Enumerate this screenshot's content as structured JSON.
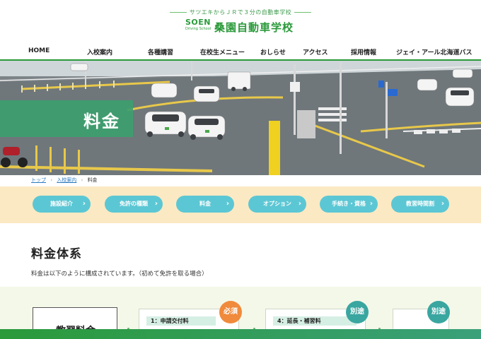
{
  "header": {
    "tagline": "サツエキからＪＲで３分の自動車学校",
    "logo_mark": "SOEN",
    "logo_sub": "Driving School",
    "school_name": "桑園自動車学校"
  },
  "nav": {
    "items": [
      {
        "label": "HOME"
      },
      {
        "label": "入校案内"
      },
      {
        "label": "各種講習"
      },
      {
        "label": "在校生メニュー"
      },
      {
        "label": "おしらせ"
      },
      {
        "label": "アクセス"
      },
      {
        "label": "採用情報"
      },
      {
        "label": "ジェイ・アール北海道バス"
      }
    ]
  },
  "hero": {
    "title": "料金"
  },
  "breadcrumb": {
    "items": [
      {
        "label": "トップ"
      },
      {
        "label": "入校案内"
      },
      {
        "label": "料金"
      }
    ]
  },
  "subnav": {
    "items": [
      {
        "label": "施設紹介"
      },
      {
        "label": "免許の種類"
      },
      {
        "label": "料金"
      },
      {
        "label": "オプション"
      },
      {
        "label": "手続き・資格"
      },
      {
        "label": "教習時間割"
      }
    ]
  },
  "section": {
    "title": "料金体系",
    "desc": "料金は以下のように構成されています。（初めて免許を取る場合）"
  },
  "fees": {
    "main_label": "教習料金",
    "cards": [
      {
        "label": "1：申請交付料",
        "badge": "必須"
      },
      {
        "label": "4：延長・補習料",
        "badge": "別途"
      },
      {
        "label": "",
        "badge": "別途"
      }
    ]
  },
  "colors": {
    "brand_green": "#2a9a3a",
    "pill_teal": "#5cc7d4",
    "band_cream": "#fbe9c3",
    "badge_orange": "#f08a3c",
    "badge_teal": "#3aa6a0"
  }
}
